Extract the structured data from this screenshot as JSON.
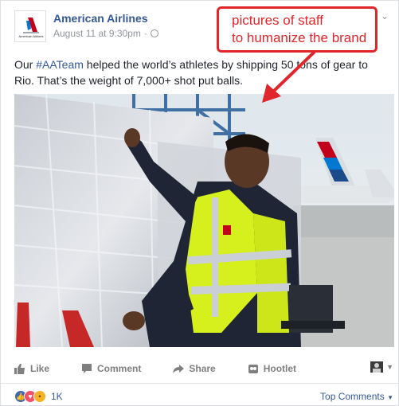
{
  "post": {
    "page_name": "American Airlines",
    "timestamp": "August 11 at 9:30pm",
    "separator": "·",
    "text_before": "Our ",
    "hashtag": "#AATeam",
    "text_after": " helped the world’s athletes by shipping 50 tons of gear to Rio. That’s the weight of 7,000+ shot put balls."
  },
  "annotation": {
    "line1": "pictures of staff",
    "line2": "to humanize the brand",
    "color": "#e0262a"
  },
  "actions": {
    "like": "Like",
    "comment": "Comment",
    "share": "Share",
    "hootlet": "Hootlet"
  },
  "reactions": {
    "count": "1K",
    "types": [
      "like",
      "love",
      "wow"
    ],
    "top_comments": "Top Comments"
  },
  "colors": {
    "link": "#365899",
    "meta": "#90949c",
    "vest": "#d6f01e"
  }
}
